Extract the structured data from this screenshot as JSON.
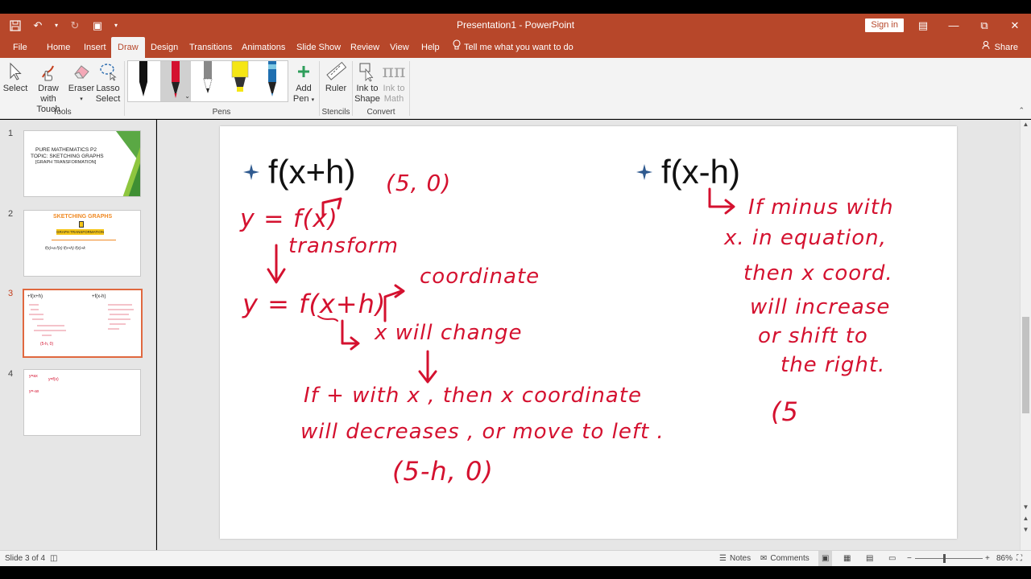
{
  "window": {
    "title": "Presentation1  -  PowerPoint",
    "sign_in": "Sign in"
  },
  "tabs": [
    "File",
    "Home",
    "Insert",
    "Draw",
    "Design",
    "Transitions",
    "Animations",
    "Slide Show",
    "Review",
    "View",
    "Help"
  ],
  "active_tab": "Draw",
  "tell_me": "Tell me what you want to do",
  "share": "Share",
  "ribbon": {
    "tools": {
      "select": "Select",
      "draw_touch_1": "Draw with",
      "draw_touch_2": "Touch",
      "eraser": "Eraser",
      "lasso_1": "Lasso",
      "lasso_2": "Select",
      "label": "Tools"
    },
    "pens": {
      "label": "Pens",
      "add_pen_1": "Add",
      "add_pen_2": "Pen",
      "colors": [
        "#111111",
        "#d4112f",
        "#222222",
        "#f5e614",
        "#1f6fb0"
      ]
    },
    "stencils": {
      "ruler": "Ruler",
      "label": "Stencils"
    },
    "convert": {
      "ink_shape_1": "Ink to",
      "ink_shape_2": "Shape",
      "ink_math_1": "Ink to",
      "ink_math_2": "Math",
      "label": "Convert"
    }
  },
  "thumbnails": [
    {
      "num": "1",
      "line1": "PURE MATHEMATICS P2",
      "line2": "TOPIC: SKETCHING GRAPHS",
      "line3": "[GRAPH TRANSFORMATION]"
    },
    {
      "num": "2",
      "line1": "SKETCHING GRAPHS",
      "line2": "GRAPH TRANSFORMATION",
      "line3": "f(x)+a   f(x)   f(x+h)   f(x)+k"
    },
    {
      "num": "3",
      "line1": "+f(x+h)",
      "line2": "+f(x-h)",
      "line3": "(5-h, 0)"
    },
    {
      "num": "4",
      "line1": "y=ax",
      "line2": "y=f(x)",
      "line3": "y=-ax"
    }
  ],
  "slide": {
    "heading_left": "f(x+h)",
    "heading_right": "f(x-h)",
    "ink": {
      "point": "(5, 0)",
      "yfx": "y = f(x)",
      "transform": "transform",
      "yfxh": "y = f(x+h)",
      "coordinate": "coordinate",
      "x_change": "x will change",
      "line1": "If + with x , then x coordinate",
      "line2": "will decreases , or move to left .",
      "result": "(5-h, 0)",
      "r1": "If minus with",
      "r2": "x. in equation,",
      "r3": "then x coord.",
      "r4": "will increase",
      "r5": "or shift to",
      "r6": "the right.",
      "r7": "(5"
    }
  },
  "status": {
    "slide_info": "Slide 3 of 4",
    "notes": "Notes",
    "comments": "Comments",
    "zoom": "86%",
    "zoom_value": 86
  }
}
